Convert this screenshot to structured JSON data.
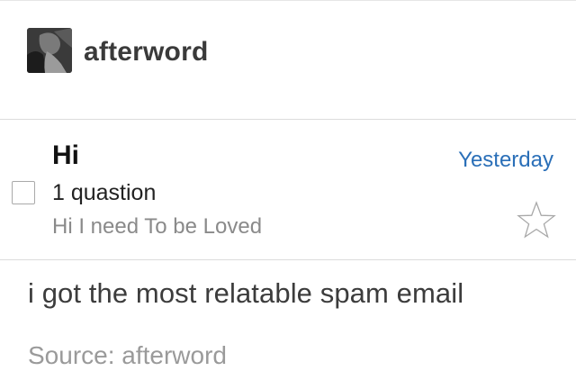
{
  "post": {
    "author": {
      "username": "afterword",
      "avatar_icon": "user-avatar-photo"
    },
    "caption": "i got the most relatable spam email",
    "source": {
      "prefix": "Source: ",
      "name": "afterword"
    }
  },
  "email": {
    "subject": "Hi",
    "date": "Yesterday",
    "sender": "1 quastion",
    "preview": "Hi I need To be Loved",
    "checked": false,
    "starred": false,
    "star_icon": "star-outline-icon",
    "checkbox_icon": "checkbox-icon"
  },
  "colors": {
    "date_link": "#2a6fb8",
    "preview_text": "#8a8a8a",
    "source_text": "#9a9a9a",
    "divider": "#dcdcdc"
  }
}
